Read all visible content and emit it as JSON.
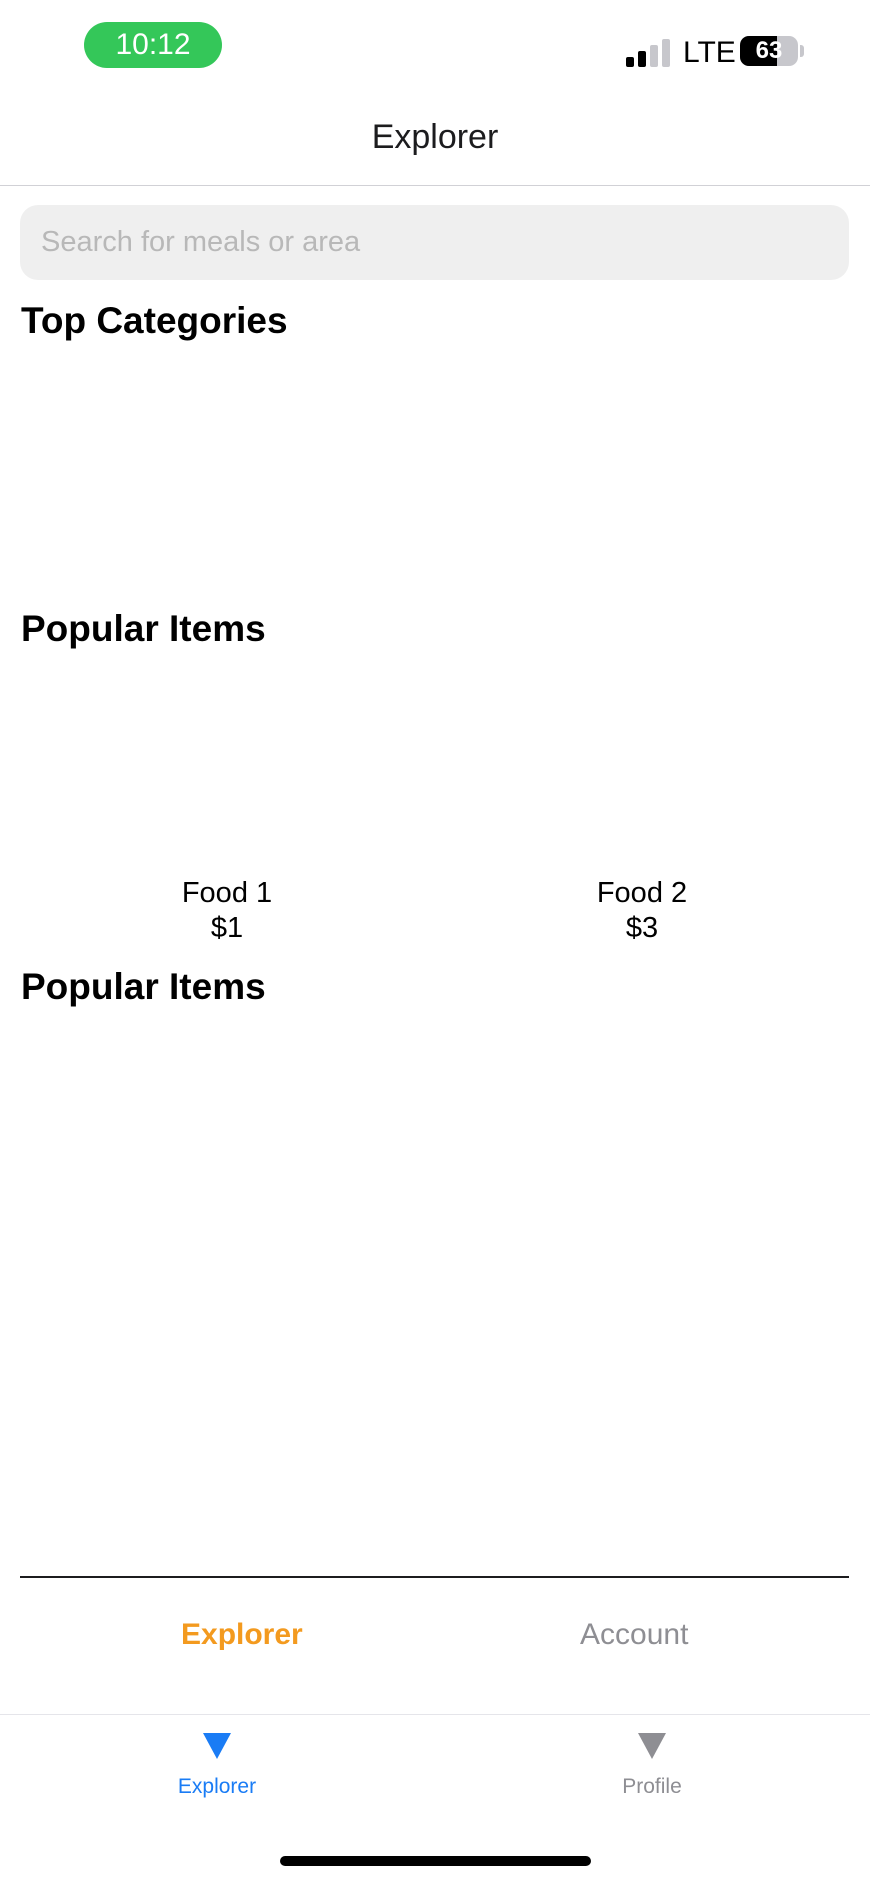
{
  "status_bar": {
    "time": "10:12",
    "network": "LTE",
    "battery": "63",
    "battery_level": 0.63
  },
  "header": {
    "title": "Explorer"
  },
  "search": {
    "placeholder": "Search for meals or area"
  },
  "sections": {
    "top_categories": "Top Categories",
    "popular_items": "Popular Items",
    "popular_items_2": "Popular Items"
  },
  "popular_items": [
    {
      "name": "Food 1",
      "price": "$1"
    },
    {
      "name": "Food 2",
      "price": "$3"
    }
  ],
  "inner_tabs": [
    {
      "label": "Explorer",
      "active": true
    },
    {
      "label": "Account",
      "active": false
    }
  ],
  "tab_bar": [
    {
      "label": "Explorer",
      "icon": "triangle-down-icon",
      "active": true
    },
    {
      "label": "Profile",
      "icon": "triangle-down-icon",
      "active": false
    }
  ],
  "colors": {
    "accent_orange": "#f39a1f",
    "tab_active_blue": "#1a7cf5",
    "tab_inactive_gray": "#8e8e93",
    "time_pill_green": "#34c759"
  }
}
